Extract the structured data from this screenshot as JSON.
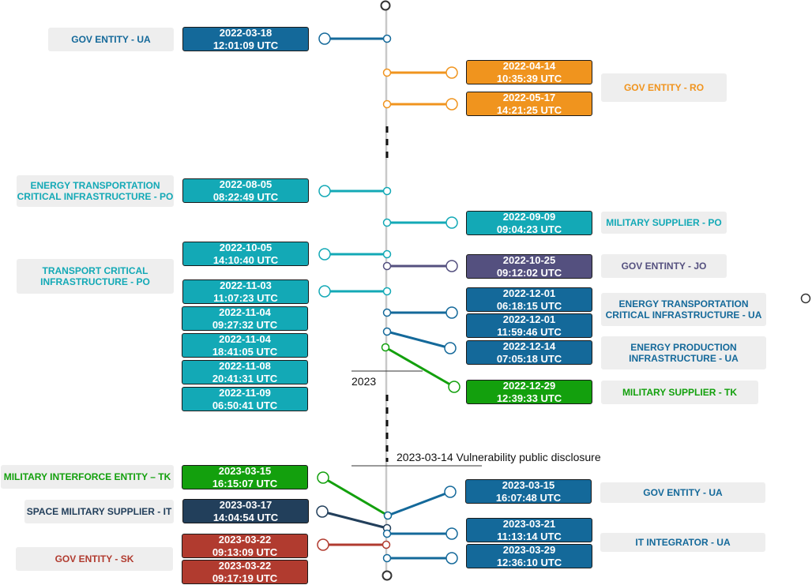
{
  "colors": {
    "gov_ua": "#14699a",
    "gov_ro": "#f0941e",
    "teal": "#13a9b6",
    "jo": "#54507f",
    "green": "#13a00d",
    "navy": "#223f5b",
    "sk": "#b13b2f",
    "axis": "#c8c8c8"
  },
  "annotations": {
    "year_marker": "2023",
    "disclosure": "2023-03-14 Vulnerability public disclosure"
  },
  "entities": [
    {
      "label": "GOV ENTITY - UA",
      "color": "#14699a"
    },
    {
      "label": "GOV ENTITY - RO",
      "color": "#f0941e"
    },
    {
      "label": "ENERGY TRANSPORTATION CRITICAL INFRASTRUCTURE - PO",
      "color": "#13a9b6"
    },
    {
      "label": "MILITARY SUPPLIER - PO",
      "color": "#13a9b6"
    },
    {
      "label": "TRANSPORT CRITICAL INFRASTRUCTURE - PO",
      "color": "#13a9b6"
    },
    {
      "label": "GOV ENTINTY - JO",
      "color": "#54507f"
    },
    {
      "label": "ENERGY TRANSPORTATION CRITICAL INFRASTRUCTURE - UA",
      "color": "#14699a"
    },
    {
      "label": "ENERGY PRODUCTION INFRASTRUCTURE - UA",
      "color": "#14699a"
    },
    {
      "label": "MILITARY SUPPLIER - TK",
      "color": "#13a00d"
    },
    {
      "label": "MILITARY INTERFORCE ENTITY – TK",
      "color": "#13a00d"
    },
    {
      "label": "SPACE MILITARY SUPPLIER - IT",
      "color": "#223f5b"
    },
    {
      "label": "GOV ENTITY - UA",
      "color": "#14699a"
    },
    {
      "label": "GOV ENTITY - SK",
      "color": "#b13b2f"
    },
    {
      "label": "IT INTEGRATOR - UA",
      "color": "#14699a"
    }
  ],
  "events": [
    {
      "date": "2022-03-18",
      "time": "12:01:09 UTC",
      "color": "#14699a"
    },
    {
      "date": "2022-04-14",
      "time": "10:35:39 UTC",
      "color": "#f0941e"
    },
    {
      "date": "2022-05-17",
      "time": "14:21:25 UTC",
      "color": "#f0941e"
    },
    {
      "date": "2022-08-05",
      "time": "08:22:49 UTC",
      "color": "#13a9b6"
    },
    {
      "date": "2022-09-09",
      "time": "09:04:23 UTC",
      "color": "#13a9b6"
    },
    {
      "date": "2022-10-05",
      "time": "14:10:40 UTC",
      "color": "#13a9b6"
    },
    {
      "date": "2022-10-25",
      "time": "09:12:02 UTC",
      "color": "#54507f"
    },
    {
      "date": "2022-11-03",
      "time": "11:07:23 UTC",
      "color": "#13a9b6"
    },
    {
      "date": "2022-11-04",
      "time": "09:27:32 UTC",
      "color": "#13a9b6"
    },
    {
      "date": "2022-11-04",
      "time": "18:41:05 UTC",
      "color": "#13a9b6"
    },
    {
      "date": "2022-11-08",
      "time": "20:41:31 UTC",
      "color": "#13a9b6"
    },
    {
      "date": "2022-11-09",
      "time": "06:50:41 UTC",
      "color": "#13a9b6"
    },
    {
      "date": "2022-12-01",
      "time": "06:18:15 UTC",
      "color": "#14699a"
    },
    {
      "date": "2022-12-01",
      "time": "11:59:46 UTC",
      "color": "#14699a"
    },
    {
      "date": "2022-12-14",
      "time": "07:05:18 UTC",
      "color": "#14699a"
    },
    {
      "date": "2022-12-29",
      "time": "12:39:33 UTC",
      "color": "#13a00d"
    },
    {
      "date": "2023-03-15",
      "time": "16:15:07 UTC",
      "color": "#13a00d"
    },
    {
      "date": "2023-03-15",
      "time": "16:07:48 UTC",
      "color": "#14699a"
    },
    {
      "date": "2023-03-17",
      "time": "14:04:54 UTC",
      "color": "#223f5b"
    },
    {
      "date": "2023-03-21",
      "time": "11:13:14 UTC",
      "color": "#14699a"
    },
    {
      "date": "2023-03-22",
      "time": "09:13:09 UTC",
      "color": "#b13b2f"
    },
    {
      "date": "2023-03-22",
      "time": "09:17:19 UTC",
      "color": "#b13b2f"
    },
    {
      "date": "2023-03-29",
      "time": "12:36:10 UTC",
      "color": "#14699a"
    }
  ]
}
